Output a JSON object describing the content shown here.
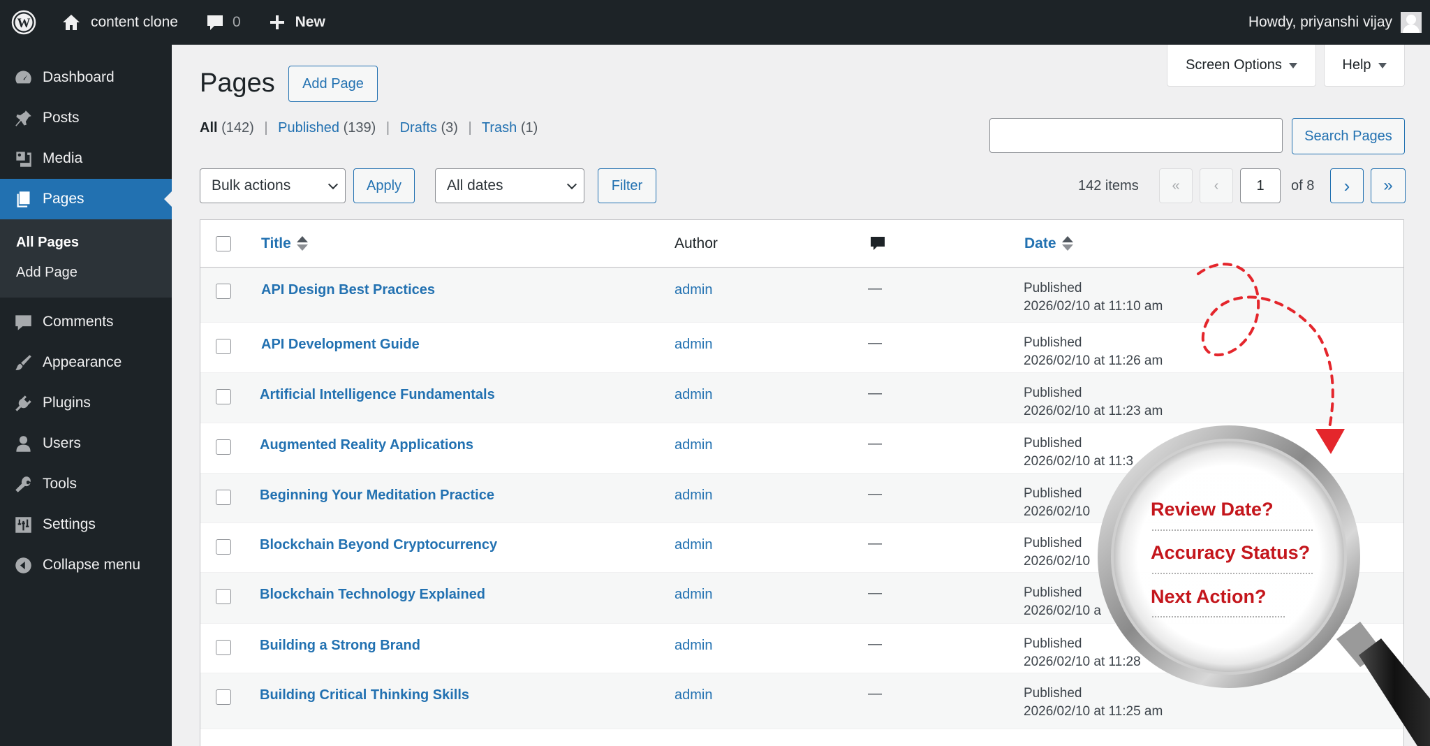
{
  "adminbar": {
    "site_name": "content clone",
    "comments_count": "0",
    "new_label": "New",
    "greeting": "Howdy, priyanshi vijay"
  },
  "sidebar": {
    "items": [
      {
        "label": "Dashboard",
        "icon": "dashboard-icon"
      },
      {
        "label": "Posts",
        "icon": "pin-icon"
      },
      {
        "label": "Media",
        "icon": "media-icon"
      },
      {
        "label": "Pages",
        "icon": "pages-icon"
      },
      {
        "label": "Comments",
        "icon": "comment-icon"
      },
      {
        "label": "Appearance",
        "icon": "brush-icon"
      },
      {
        "label": "Plugins",
        "icon": "plugin-icon"
      },
      {
        "label": "Users",
        "icon": "user-icon"
      },
      {
        "label": "Tools",
        "icon": "wrench-icon"
      },
      {
        "label": "Settings",
        "icon": "settings-icon"
      },
      {
        "label": "Collapse menu",
        "icon": "collapse-icon"
      }
    ],
    "submenu": [
      "All Pages",
      "Add Page"
    ]
  },
  "header": {
    "title": "Pages",
    "add_page": "Add Page",
    "screen_options": "Screen Options",
    "help": "Help"
  },
  "filters": {
    "all_label": "All",
    "all_count": "(142)",
    "published_label": "Published",
    "published_count": "(139)",
    "drafts_label": "Drafts",
    "drafts_count": "(3)",
    "trash_label": "Trash",
    "trash_count": "(1)"
  },
  "search": {
    "value": "",
    "button": "Search Pages"
  },
  "tablenav": {
    "bulk_actions": "Bulk actions",
    "apply": "Apply",
    "dates": "All dates",
    "filter": "Filter",
    "items": "142 items",
    "first": "«",
    "prev": "‹",
    "page": "1",
    "of": "of 8",
    "next": "›",
    "last": "»"
  },
  "table": {
    "columns": {
      "title": "Title",
      "author": "Author",
      "date": "Date"
    },
    "rows": [
      {
        "title": "API Design Best Practices",
        "author": "admin",
        "comments": "—",
        "status": "Published",
        "date": "2026/02/10 at 11:10 am"
      },
      {
        "title": "API Development Guide",
        "author": "admin",
        "comments": "—",
        "status": "Published",
        "date": "2026/02/10 at 11:26 am"
      },
      {
        "title": "Artificial Intelligence Fundamentals",
        "author": "admin",
        "comments": "—",
        "status": "Published",
        "date": "2026/02/10 at 11:23 am"
      },
      {
        "title": "Augmented Reality Applications",
        "author": "admin",
        "comments": "—",
        "status": "Published",
        "date": "2026/02/10 at 11:3"
      },
      {
        "title": "Beginning Your Meditation Practice",
        "author": "admin",
        "comments": "—",
        "status": "Published",
        "date": "2026/02/10"
      },
      {
        "title": "Blockchain Beyond Cryptocurrency",
        "author": "admin",
        "comments": "—",
        "status": "Published",
        "date": "2026/02/10"
      },
      {
        "title": "Blockchain Technology Explained",
        "author": "admin",
        "comments": "—",
        "status": "Published",
        "date": "2026/02/10 a"
      },
      {
        "title": "Building a Strong Brand",
        "author": "admin",
        "comments": "—",
        "status": "Published",
        "date": "2026/02/10 at 11:28"
      },
      {
        "title": "Building Critical Thinking Skills",
        "author": "admin",
        "comments": "—",
        "status": "Published",
        "date": "2026/02/10 at 11:25 am"
      }
    ]
  },
  "magnifier": {
    "questions": [
      "Review Date?",
      "Accuracy Status?",
      "Next Action?"
    ],
    "accent": "#c4161c"
  },
  "colors": {
    "primary": "#2271b1",
    "adminbar": "#1d2327"
  }
}
